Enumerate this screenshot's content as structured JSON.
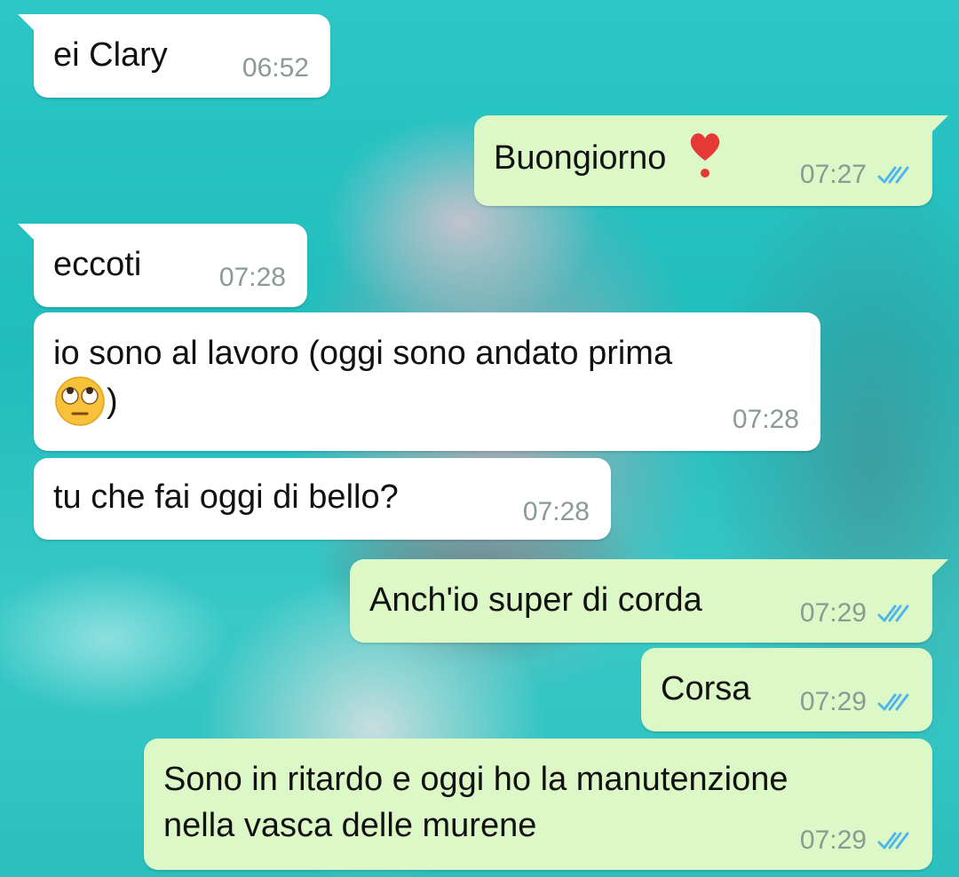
{
  "chat": {
    "messages": [
      {
        "direction": "incoming",
        "text": "ei Clary",
        "time": "06:52"
      },
      {
        "direction": "outgoing",
        "text": "Buongiorno",
        "emoji": "red-heart-exclamation-icon",
        "time": "07:27",
        "status": "read"
      },
      {
        "direction": "incoming",
        "text": "eccoti",
        "time": "07:28"
      },
      {
        "direction": "incoming",
        "text": "io sono al lavoro (oggi sono andato prima",
        "text2": ")",
        "emoji": "face-with-rolling-eyes-icon",
        "time": "07:28"
      },
      {
        "direction": "incoming",
        "text": "tu che fai oggi di bello?",
        "time": "07:28"
      },
      {
        "direction": "outgoing",
        "text": "Anch'io super di corda",
        "time": "07:29",
        "status": "read"
      },
      {
        "direction": "outgoing",
        "text": "Corsa",
        "time": "07:29",
        "status": "read"
      },
      {
        "direction": "outgoing",
        "text": "Sono in ritardo e oggi ho la manutenzione",
        "text2": "nella vasca delle murene",
        "time": "07:29",
        "status": "read"
      }
    ]
  },
  "colors": {
    "incoming_bubble": "#ffffff",
    "outgoing_bubble": "#dcf8c6",
    "read_ticks": "#4fb6ec",
    "timestamp": "#8a9a95"
  }
}
